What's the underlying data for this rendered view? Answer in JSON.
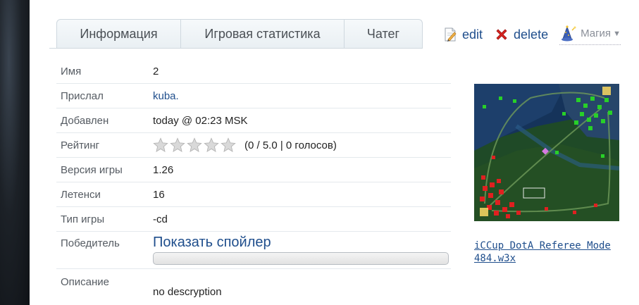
{
  "tabs": [
    {
      "label": "Информация"
    },
    {
      "label": "Игровая статистика"
    },
    {
      "label": "Чатег"
    }
  ],
  "actions": {
    "edit_label": "edit",
    "delete_label": "delete",
    "magic_label": "Магия"
  },
  "info": {
    "name": {
      "label": "Имя",
      "value": "2"
    },
    "sender": {
      "label": "Прислал",
      "value": "kuba."
    },
    "added": {
      "label": "Добавлен",
      "value": "today @ 02:23 MSK"
    },
    "rating": {
      "label": "Рейтинг",
      "stars_filled": 0,
      "stars_total": 5,
      "text": "(0 / 5.0 | 0 голосов)"
    },
    "version": {
      "label": "Версия игры",
      "value": "1.26"
    },
    "latency": {
      "label": "Летенси",
      "value": "16"
    },
    "game_type": {
      "label": "Тип игры",
      "value": "-cd"
    },
    "winner": {
      "label": "Победитель",
      "spoiler_label": "Показать спойлер"
    },
    "description": {
      "label": "Описание",
      "value": "no descryption"
    }
  },
  "map": {
    "link_text": "iCCup DotA Referee Mode 484.w3x"
  },
  "colors": {
    "link": "#1f4e8c",
    "sentinel": "#e02020",
    "scourge": "#28d028"
  }
}
